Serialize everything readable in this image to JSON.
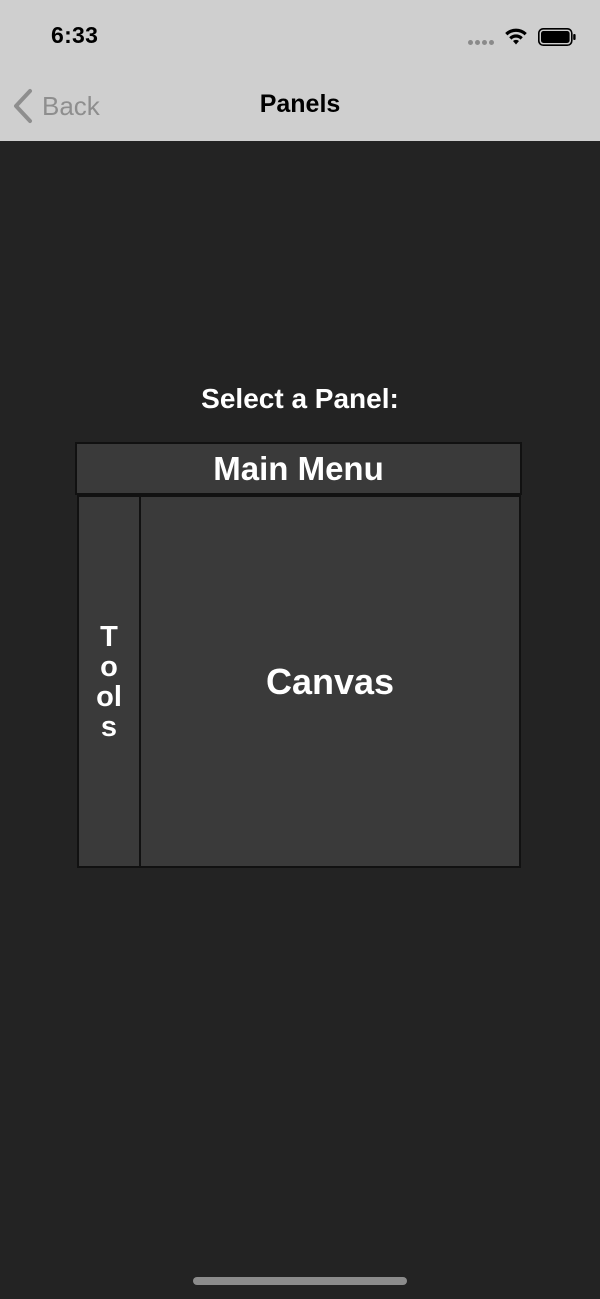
{
  "status_bar": {
    "time": "6:33",
    "icons": [
      "signal-dots-icon",
      "wifi-icon",
      "battery-icon"
    ]
  },
  "nav_bar": {
    "back_label": "Back",
    "title": "Panels"
  },
  "main": {
    "prompt": "Select a Panel:",
    "panels": {
      "main_menu": "Main Menu",
      "tools": "Tools",
      "canvas": "Canvas"
    }
  },
  "colors": {
    "background": "#232323",
    "header": "#cfcfcf",
    "panel": "#3a3a3a",
    "panel_border": "#111111",
    "text_light": "#ffffff",
    "back_text": "#8e8e8e"
  }
}
